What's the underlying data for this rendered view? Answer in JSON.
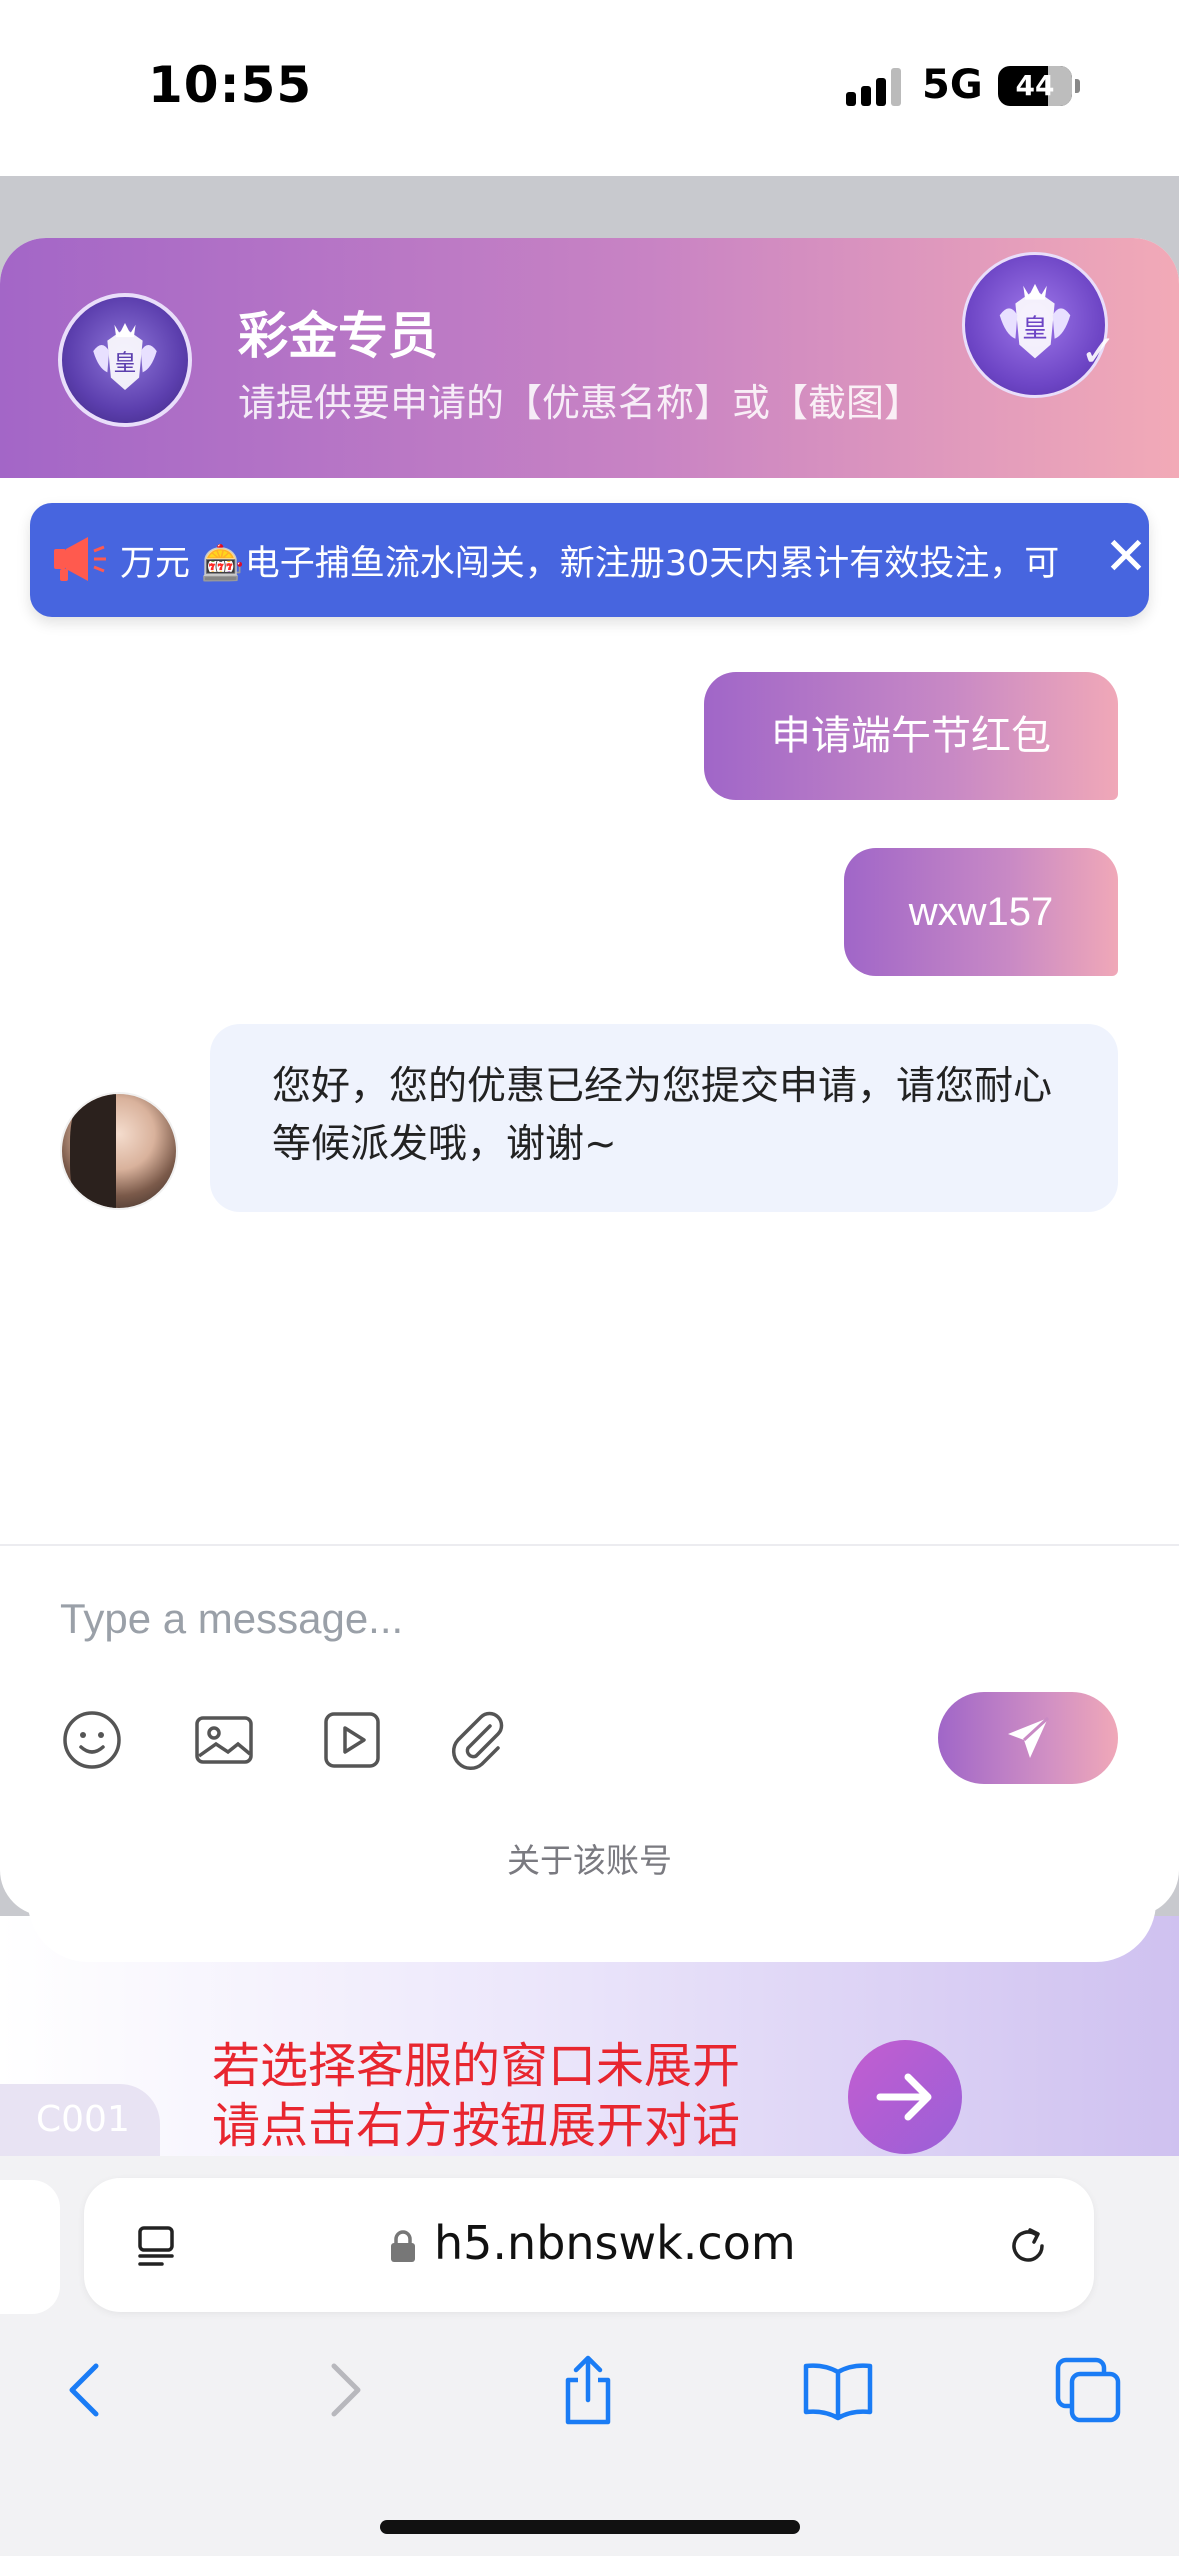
{
  "status_bar": {
    "time": "10:55",
    "network": "5G",
    "battery": "44"
  },
  "chat_header": {
    "title": "彩金专员",
    "subtitle": "请提供要申请的【优惠名称】或【截图】"
  },
  "notice": {
    "text": "万元 🎰电子捕鱼流水闯关，新注册30天内累计有效投注，可",
    "close_glyph": "✕"
  },
  "messages": [
    {
      "from": "user",
      "text": "申请端午节红包"
    },
    {
      "from": "user",
      "text": "wxw157"
    },
    {
      "from": "agent",
      "text": "您好，您的优惠已经为您提交申请，请您耐心等候派发哦，谢谢~"
    }
  ],
  "composer": {
    "placeholder": "Type a message..."
  },
  "toolbar_icons": [
    "emoji-icon",
    "image-icon",
    "video-icon",
    "attachment-icon",
    "send-icon"
  ],
  "about": "关于该账号",
  "banner": {
    "line1": "若选择客服的窗口未展开",
    "line2": "请点击右方按钮展开对话",
    "code": "C001"
  },
  "browser": {
    "url": "h5.nbnswk.com",
    "nav_icons": [
      "back-icon",
      "forward-icon",
      "share-icon",
      "bookmarks-icon",
      "tabs-icon"
    ]
  },
  "colors": {
    "header_gradient_start": "#a366c7",
    "header_gradient_end": "#f2aab7",
    "notice_bg": "#4765df",
    "banner_text": "#e8262f",
    "ios_blue": "#1a7cf5"
  }
}
